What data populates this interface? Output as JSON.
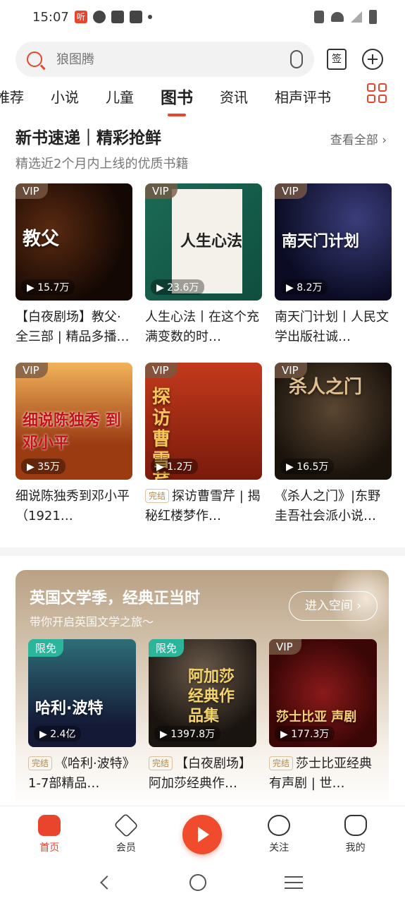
{
  "status_bar": {
    "time": "15:07",
    "app_badge": "听"
  },
  "search": {
    "placeholder": "狼图腾"
  },
  "header": {
    "sign_label": "签"
  },
  "tabs": [
    {
      "label": "推荐"
    },
    {
      "label": "小说"
    },
    {
      "label": "儿童"
    },
    {
      "label": "图书",
      "active": true
    },
    {
      "label": "资讯"
    },
    {
      "label": "相声评书"
    }
  ],
  "section_new": {
    "title": "新书速递｜精彩抢鲜",
    "more": "查看全部 ›",
    "subtitle": "精选近2个月内上线的优质书籍",
    "cards": [
      {
        "badge": "VIP",
        "plays": "▶ 15.7万",
        "cover_text": "教父",
        "title": "【白夜剧场】教父·全三部 | 精品多播…"
      },
      {
        "badge": "VIP",
        "plays": "▶ 23.6万",
        "cover_text": "人生心法",
        "title": "人生心法丨在这个充满变数的时…"
      },
      {
        "badge": "VIP",
        "plays": "▶ 8.2万",
        "cover_text": "南天门计划",
        "title": "南天门计划丨人民文学出版社诚…"
      },
      {
        "badge": "VIP",
        "plays": "▶ 35万",
        "cover_text": "细说陈独秀 到邓小平",
        "title": "细说陈独秀到邓小平（1921…"
      },
      {
        "badge": "VIP",
        "plays": "▶ 1.2万",
        "cover_text": "探访曹雪芹",
        "tag": "完结",
        "title": "探访曹雪芹 | 揭秘红楼梦作…"
      },
      {
        "badge": "VIP",
        "plays": "▶ 16.5万",
        "cover_text": "杀人之门",
        "title": "《杀人之门》|东野圭吾社会派小说…"
      }
    ]
  },
  "promo": {
    "title": "英国文学季，经典正当时",
    "subtitle": "带你开启英国文学之旅～",
    "button": "进入空间 ›",
    "cards": [
      {
        "badge": "限免",
        "plays": "▶ 2.4亿",
        "cover_text": "哈利·波特",
        "tag": "完结",
        "title": "《哈利·波特》1-7部精品…"
      },
      {
        "badge": "限免",
        "plays": "▶ 1397.8万",
        "cover_text": "阿加莎经典作品集",
        "tag": "完结",
        "title": "【白夜剧场】阿加莎经典作…"
      },
      {
        "badge": "VIP",
        "plays": "▶ 177.3万",
        "cover_text": "莎士比亚 声剧",
        "tag": "完结",
        "title": "莎士比亚经典有声剧 | 世…"
      }
    ]
  },
  "bottom_nav": {
    "home": "首页",
    "vip": "会员",
    "follow": "关注",
    "me": "我的"
  },
  "colors": {
    "accent": "#e8452c"
  }
}
